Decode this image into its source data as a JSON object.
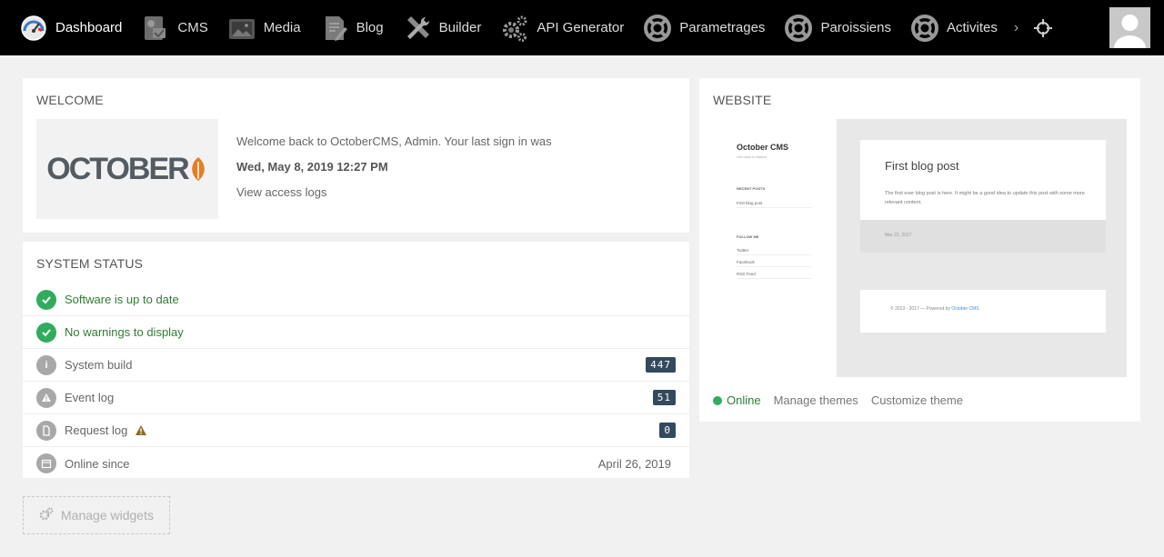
{
  "nav": {
    "items": [
      {
        "label": "Dashboard",
        "icon": "dashboard-gauge-icon"
      },
      {
        "label": "CMS",
        "icon": "cms-icon"
      },
      {
        "label": "Media",
        "icon": "media-icon"
      },
      {
        "label": "Blog",
        "icon": "blog-icon"
      },
      {
        "label": "Builder",
        "icon": "builder-tools-icon"
      },
      {
        "label": "API Generator",
        "icon": "gears-icon"
      },
      {
        "label": "Parametrages",
        "icon": "lifebuoy-icon"
      },
      {
        "label": "Paroissiens",
        "icon": "lifebuoy-icon"
      },
      {
        "label": "Activites",
        "icon": "lifebuoy-icon"
      }
    ],
    "more": "›"
  },
  "welcome": {
    "title": "WELCOME",
    "logo_text": "OCTOBER",
    "message": "Welcome back to OctoberCMS, Admin. Your last sign in was",
    "last_signin": "Wed, May 8, 2019 12:27 PM",
    "access_logs": "View access logs"
  },
  "status": {
    "title": "SYSTEM STATUS",
    "rows": [
      {
        "label": "Software is up to date"
      },
      {
        "label": "No warnings to display"
      },
      {
        "label": "System build",
        "badge": "447"
      },
      {
        "label": "Event log",
        "badge": "51"
      },
      {
        "label": "Request log",
        "badge": "0"
      },
      {
        "label": "Online since",
        "value": "April 26, 2019"
      }
    ]
  },
  "manage_widgets": "Manage widgets",
  "website": {
    "title": "WEBSITE",
    "preview": {
      "brand": "October CMS",
      "tagline": "Get back to basics",
      "recent_heading": "RECENT POSTS",
      "recent_item": "First blog post",
      "follow_heading": "FOLLOW ME",
      "follow_links": [
        "Twitter",
        "Facebook",
        "RSS Feed"
      ],
      "post_title": "First blog post",
      "post_text": "The first ever blog post is here. It might be a good idea to update this post with some more relevant content.",
      "post_date": "Mar 22, 2017",
      "footer_text": "© 2013 - 2017 — Powered by",
      "footer_link": "October CMS"
    },
    "online": "Online",
    "manage_themes": "Manage themes",
    "customize_theme": "Customize theme"
  },
  "colors": {
    "nav_bg": "#000000",
    "success": "#31ac5f",
    "badge_bg": "#34495e",
    "october_orange": "#e67e22"
  }
}
